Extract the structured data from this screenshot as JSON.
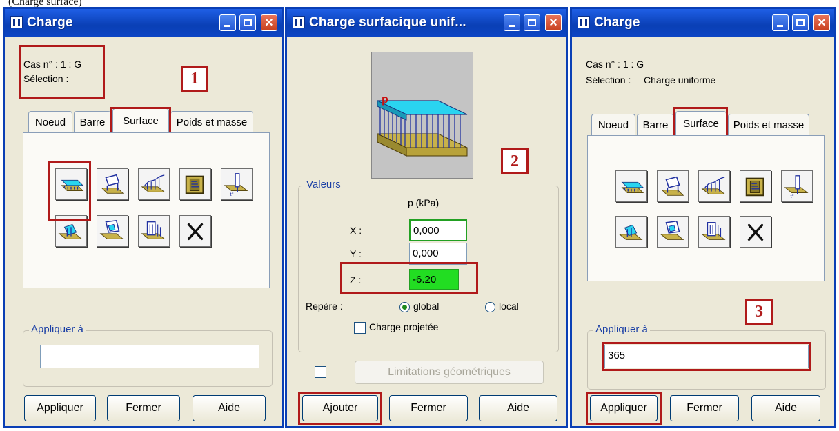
{
  "caption": "(Charge surface)",
  "colors": {
    "highlight_box": "#b01a1a",
    "title_bar": "#0a3fb5",
    "value_ok": "#22a022",
    "value_active_bg": "#22dd22"
  },
  "windows": [
    {
      "title": "Charge",
      "case_line": "Cas n° : 1 : G",
      "selection_label": "Sélection :",
      "selection_value": "",
      "marker": "1",
      "tabs": [
        "Noeud",
        "Barre",
        "Surface",
        "Poids et masse"
      ],
      "active_tab": "Surface",
      "icons": [
        "uniform-load-icon",
        "planar-load-icon",
        "linear-load-3p-icon",
        "hydrostatic-load-icon",
        "point-load-icon",
        "linear-load-edge-icon",
        "contour-load-icon",
        "thermal-load-icon",
        "delete-icon"
      ],
      "apply_group_label": "Appliquer à",
      "apply_value": "",
      "buttons": [
        "Appliquer",
        "Fermer",
        "Aide"
      ]
    },
    {
      "title": "Charge surfacique unif...",
      "preview_label": "p",
      "marker": "2",
      "values_group_label": "Valeurs",
      "column_header": "p  (kPa)",
      "x_label": "X :",
      "x_value": "0,000",
      "y_label": "Y :",
      "y_value": "0,000",
      "z_label": "Z :",
      "z_value": "-6.20",
      "repere_label": "Repère :",
      "radio_global": "global",
      "radio_local": "local",
      "checkbox_projected": "Charge projetée",
      "geo_limits_button": "Limitations géométriques",
      "buttons": [
        "Ajouter",
        "Fermer",
        "Aide"
      ]
    },
    {
      "title": "Charge",
      "case_line": "Cas n° : 1 : G",
      "selection_label": "Sélection :",
      "selection_value": "Charge uniforme",
      "marker": "3",
      "tabs": [
        "Noeud",
        "Barre",
        "Surface",
        "Poids et masse"
      ],
      "active_tab": "Surface",
      "icons": [
        "uniform-load-icon",
        "planar-load-icon",
        "linear-load-3p-icon",
        "hydrostatic-load-icon",
        "point-load-icon",
        "linear-load-edge-icon",
        "contour-load-icon",
        "thermal-load-icon",
        "delete-icon"
      ],
      "apply_group_label": "Appliquer à",
      "apply_value": "365",
      "buttons": [
        "Appliquer",
        "Fermer",
        "Aide"
      ]
    }
  ]
}
